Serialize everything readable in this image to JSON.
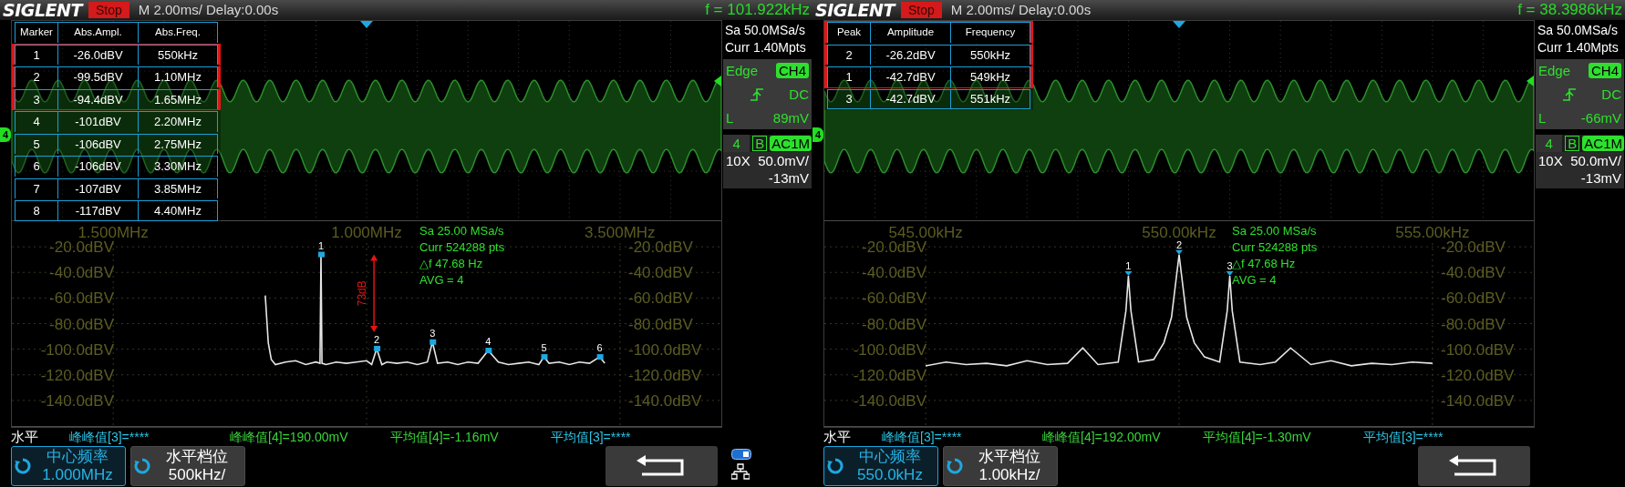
{
  "panels": [
    {
      "header": {
        "logo": "SIGLENT",
        "run_state": "Stop",
        "timebase": "M 2.00ms/ Delay:0.00s",
        "trigger_frequency": "f = 101.922kHz"
      },
      "display": {
        "channel_marker": "4",
        "table": {
          "header_highlighted": false,
          "columns": [
            "Marker",
            "Abs.Ampl.",
            "Abs.Freq."
          ],
          "rows": [
            {
              "cells": [
                "1",
                "-26.0dBV",
                "550kHz"
              ],
              "highlighted": true
            },
            {
              "cells": [
                "2",
                "-99.5dBV",
                "1.10MHz"
              ],
              "highlighted": true
            },
            {
              "cells": [
                "3",
                "-94.4dBV",
                "1.65MHz"
              ],
              "highlighted": true
            },
            {
              "cells": [
                "4",
                "-101dBV",
                "2.20MHz"
              ],
              "highlighted": false
            },
            {
              "cells": [
                "5",
                "-106dBV",
                "2.75MHz"
              ],
              "highlighted": false
            },
            {
              "cells": [
                "6",
                "-106dBV",
                "3.30MHz"
              ],
              "highlighted": false
            },
            {
              "cells": [
                "7",
                "-107dBV",
                "3.85MHz"
              ],
              "highlighted": false
            },
            {
              "cells": [
                "8",
                "-117dBV",
                "4.40MHz"
              ],
              "highlighted": false
            }
          ]
        },
        "info": [
          "Sa 25.00 MSa/s",
          "Curr 524288 pts",
          "△f 47.68 Hz",
          "AVG = 4"
        ],
        "chart_data": {
          "type": "line",
          "xlim": [
            -2.5,
            4.5
          ],
          "ylim": [
            -160,
            0
          ],
          "grid": true,
          "xticks": [
            {
              "value": -1.5,
              "label": "1.500MHz"
            },
            {
              "value": 1,
              "label": "1.000MHz"
            },
            {
              "value": 3.5,
              "label": "3.500MHz"
            }
          ],
          "yticks": [
            {
              "value": -20,
              "label": "-20.0dBV"
            },
            {
              "value": -40,
              "label": "-40.0dBV"
            },
            {
              "value": -60,
              "label": "-60.0dBV"
            },
            {
              "value": -80,
              "label": "-80.0dBV"
            },
            {
              "value": -100,
              "label": "-100.0dBV"
            },
            {
              "value": -120,
              "label": "-120.0dBV"
            },
            {
              "value": -140,
              "label": "-140.0dBV"
            }
          ],
          "x": [
            0,
            0.03,
            0.06,
            0.1,
            0.2,
            0.3,
            0.4,
            0.5,
            0.54,
            0.55,
            0.56,
            0.6,
            0.7,
            0.8,
            0.9,
            1.0,
            1.05,
            1.1,
            1.15,
            1.2,
            1.3,
            1.4,
            1.5,
            1.6,
            1.65,
            1.7,
            1.8,
            1.9,
            2.0,
            2.1,
            2.2,
            2.3,
            2.4,
            2.5,
            2.6,
            2.7,
            2.75,
            2.8,
            2.9,
            3.0,
            3.1,
            3.2,
            3.3,
            3.35
          ],
          "series": [
            {
              "color": "#e6e6e6",
              "values": [
                -58,
                -95,
                -108,
                -112,
                -110,
                -109,
                -112,
                -110,
                -111,
                -26,
                -111,
                -112,
                -110,
                -111,
                -110,
                -109,
                -112,
                -99.5,
                -112,
                -110,
                -111,
                -110,
                -112,
                -110,
                -94.4,
                -111,
                -110,
                -112,
                -110,
                -111,
                -101,
                -110,
                -112,
                -111,
                -110,
                -112,
                -106,
                -111,
                -110,
                -112,
                -110,
                -111,
                -106,
                -111
              ]
            }
          ],
          "annotations": [
            {
              "x": 0.55,
              "y": -26,
              "text": "1"
            },
            {
              "x": 1.1,
              "y": -99.5,
              "text": "2"
            },
            {
              "x": 1.65,
              "y": -94.4,
              "text": "3"
            },
            {
              "x": 2.2,
              "y": -101,
              "text": "4"
            },
            {
              "x": 2.75,
              "y": -106,
              "text": "5"
            },
            {
              "x": 3.3,
              "y": -106,
              "text": "6"
            }
          ]
        },
        "marker_shape": {
          "kind": "square"
        },
        "delta_arrow": {
          "label": "73dB"
        }
      },
      "sidebar": {
        "sample_rate": "Sa 50.0MSa/s",
        "memory": "Curr 1.40Mpts",
        "trigger": {
          "type": "Edge",
          "source": "CH4",
          "coupling": "DC",
          "level_label": "L",
          "level_value": "89mV"
        },
        "channel": {
          "number": "4",
          "bandwidth_limit": "B",
          "coupling": "AC1M",
          "probe": "10X",
          "scale": "50.0mV/",
          "offset": "-13mV"
        }
      },
      "status_bar": {
        "title": "水平",
        "measurements": [
          {
            "text": "峰峰值[3]=****",
            "color": "#2cc4e4"
          },
          {
            "text": "峰峰值[4]=190.00mV",
            "color": "#3ad43a"
          },
          {
            "text": "平均值[4]=-1.16mV",
            "color": "#3ad43a"
          },
          {
            "text": "平均值[3]=****",
            "color": "#2cc4e4"
          }
        ]
      },
      "softkeys": [
        {
          "label": "中心频率",
          "value": "1.000MHz",
          "selected": true
        },
        {
          "label": "水平档位",
          "value": "500kHz/",
          "selected": false
        }
      ],
      "indicators": [
        {
          "kind": "usb"
        },
        {
          "kind": "network"
        }
      ]
    },
    {
      "header": {
        "logo": "SIGLENT",
        "run_state": "Stop",
        "timebase": "M 2.00ms/ Delay:0.00s",
        "trigger_frequency": "f = 38.3986kHz"
      },
      "display": {
        "channel_marker": "4",
        "table": {
          "header_highlighted": true,
          "columns": [
            "Peak",
            "Amplitude",
            "Frequency"
          ],
          "rows": [
            {
              "cells": [
                "2",
                "-26.2dBV",
                "550kHz"
              ],
              "highlighted": true
            },
            {
              "cells": [
                "1",
                "-42.7dBV",
                "549kHz"
              ],
              "highlighted": true
            },
            {
              "cells": [
                "3",
                "-42.7dBV",
                "551kHz"
              ],
              "highlighted": false
            }
          ]
        },
        "info": [
          "Sa 25.00 MSa/s",
          "Curr 524288 pts",
          "△f 47.68 Hz",
          "AVG = 4"
        ],
        "chart_data": {
          "type": "line",
          "xlim": [
            543,
            557
          ],
          "ylim": [
            -160,
            0
          ],
          "grid": true,
          "xticks": [
            {
              "value": 545,
              "label": "545.00kHz"
            },
            {
              "value": 550,
              "label": "550.00kHz"
            },
            {
              "value": 555,
              "label": "555.00kHz"
            }
          ],
          "yticks": [
            {
              "value": -20,
              "label": "-20.0dBV"
            },
            {
              "value": -40,
              "label": "-40.0dBV"
            },
            {
              "value": -60,
              "label": "-60.0dBV"
            },
            {
              "value": -80,
              "label": "-80.0dBV"
            },
            {
              "value": -100,
              "label": "-100.0dBV"
            },
            {
              "value": -120,
              "label": "-120.0dBV"
            },
            {
              "value": -140,
              "label": "-140.0dBV"
            }
          ],
          "x": [
            545,
            545.4,
            545.8,
            546.2,
            546.6,
            547,
            547.4,
            547.8,
            548.1,
            548.4,
            548.8,
            548.95,
            549,
            549.05,
            549.2,
            549.5,
            549.7,
            549.85,
            550,
            550.15,
            550.3,
            550.5,
            550.8,
            550.95,
            551,
            551.05,
            551.2,
            551.6,
            551.9,
            552.2,
            552.6,
            553,
            553.4,
            553.8,
            554.2,
            554.6,
            555
          ],
          "series": [
            {
              "color": "#e6e6e6",
              "values": [
                -113,
                -110,
                -112,
                -111,
                -113,
                -109,
                -112,
                -111,
                -99,
                -112,
                -110,
                -70,
                -42.7,
                -70,
                -110,
                -108,
                -95,
                -75,
                -26.2,
                -75,
                -95,
                -106,
                -110,
                -70,
                -42.7,
                -70,
                -110,
                -112,
                -110,
                -99,
                -112,
                -109,
                -113,
                -111,
                -112,
                -110,
                -111
              ]
            }
          ],
          "annotations": [
            {
              "x": 549,
              "y": -42.7,
              "text": "1"
            },
            {
              "x": 550,
              "y": -26.2,
              "text": "2"
            },
            {
              "x": 551,
              "y": -42.7,
              "text": "3"
            }
          ]
        },
        "marker_shape": {
          "kind": "triangle"
        }
      },
      "sidebar": {
        "sample_rate": "Sa 50.0MSa/s",
        "memory": "Curr 1.40Mpts",
        "trigger": {
          "type": "Edge",
          "source": "CH4",
          "coupling": "DC",
          "level_label": "L",
          "level_value": "-66mV"
        },
        "channel": {
          "number": "4",
          "bandwidth_limit": "B",
          "coupling": "AC1M",
          "probe": "10X",
          "scale": "50.0mV/",
          "offset": "-13mV"
        }
      },
      "status_bar": {
        "title": "水平",
        "measurements": [
          {
            "text": "峰峰值[3]=****",
            "color": "#2cc4e4"
          },
          {
            "text": "峰峰值[4]=192.00mV",
            "color": "#3ad43a"
          },
          {
            "text": "平均值[4]=-1.30mV",
            "color": "#3ad43a"
          },
          {
            "text": "平均值[3]=****",
            "color": "#2cc4e4"
          }
        ]
      },
      "softkeys": [
        {
          "label": "中心频率",
          "value": "550.0kHz",
          "selected": true
        },
        {
          "label": "水平档位",
          "value": "1.00kHz/",
          "selected": false
        }
      ]
    }
  ]
}
